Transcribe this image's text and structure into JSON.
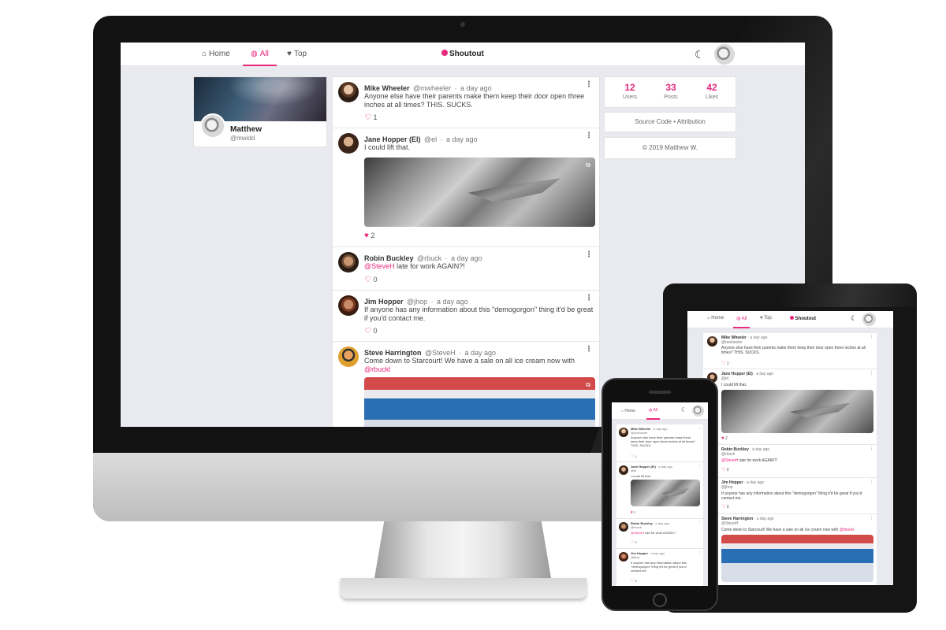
{
  "brand": "Shoutout",
  "nav": {
    "home": "Home",
    "all": "All",
    "top": "Top"
  },
  "profile": {
    "name": "Matthew",
    "handle": "@mwidd"
  },
  "stats": [
    {
      "value": "12",
      "label": "Users"
    },
    {
      "value": "33",
      "label": "Posts"
    },
    {
      "value": "42",
      "label": "Likes"
    }
  ],
  "links": {
    "source": "Source Code",
    "sep": "•",
    "attribution": "Attribution"
  },
  "copyright": "© 2019 Matthew W.",
  "posts": [
    {
      "name": "Mike Wheeler",
      "handle": "@mwheeler",
      "time": "a day ago",
      "text": "Anyone else have their parents make them keep their door open three inches at all times? THIS. SUCKS.",
      "likes": "1",
      "liked": false
    },
    {
      "name": "Jane Hopper (El)",
      "handle": "@el",
      "time": "a day ago",
      "text": "I could lift that.",
      "likes": "2",
      "liked": true
    },
    {
      "name": "Robin Buckley",
      "handle": "@rbuck",
      "time": "a day ago",
      "mention": "@SteveH",
      "text": "late for work AGAIN?!",
      "likes": "0",
      "liked": false
    },
    {
      "name": "Jim Hopper",
      "handle": "@jhop",
      "time": "a day ago",
      "text": "If anyone has any information about this \"demogorgon\" thing it'd be great if you'd contact me.",
      "likes": "0",
      "liked": false
    },
    {
      "name": "Steve Harrington",
      "handle": "@SteveH",
      "time": "a day ago",
      "text": "Come down to Starcourt! We have a sale on all ice cream now with",
      "mention": "@rbuckl",
      "likes": "",
      "liked": false
    }
  ],
  "tablet_posts": [
    {
      "name": "Mike Wheeler",
      "time": "a day ago",
      "handle": "@mwheeler",
      "text": "Anyone else have their parents make them keep their door open three inches at all times? THIS. SUCKS.",
      "likes": "1"
    },
    {
      "name": "Jane Hopper (El)",
      "time": "a day ago",
      "handle": "@el",
      "text": "I could lift that.",
      "likes": "2"
    },
    {
      "name": "Robin Buckley",
      "time": "a day ago",
      "handle": "@rbuck",
      "mention": "@SteveH",
      "text": "late for work AGAIN?!",
      "likes": "0"
    },
    {
      "name": "Jim Hopper",
      "time": "a day ago",
      "handle": "@jhop",
      "text": "If anyone has any information about this \"demogorgon\" thing it'd be great if you'd contact me.",
      "likes": "0"
    },
    {
      "name": "Steve Harrington",
      "time": "a day ago",
      "handle": "@SteveH",
      "text": "Come down to Starcourt! We have a sale on all ice cream now with",
      "mention": "@rbuckl",
      "likes": ""
    }
  ],
  "phone_posts": [
    {
      "name": "Mike Wheeler",
      "time": "a day ago",
      "handle": "@mwheeler",
      "text": "Anyone else have their parents make them keep their door open three inches at all times? THIS. SUCKS.",
      "likes": "1"
    },
    {
      "name": "Jane Hopper (El)",
      "time": "a day ago",
      "handle": "@el",
      "text": "I could lift that.",
      "likes": "2"
    },
    {
      "name": "Robin Buckley",
      "time": "a day ago",
      "handle": "@rbuck",
      "mention": "@SteveH",
      "text": "late for work AGAIN?!",
      "likes": "0"
    },
    {
      "name": "Jim Hopper",
      "time": "a day ago",
      "handle": "@jhop",
      "text": "If anyone has any information about this \"demogorgon\" thing it'd be great if you'd contact me.",
      "likes": "0"
    }
  ],
  "colors": {
    "accent": "#e8287d",
    "background": "#e9eaef"
  }
}
